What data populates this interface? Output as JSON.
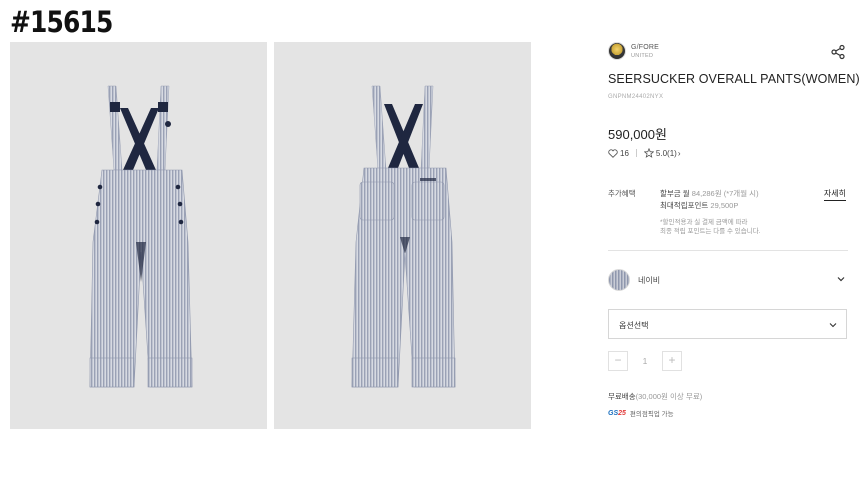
{
  "overlay_id": "#15615",
  "brand": {
    "name": "G/FORE",
    "sub": "UNITED"
  },
  "product": {
    "title": "SEERSUCKER OVERALL PANTS(WOMEN)",
    "code": "GNPNM24402NYX",
    "price": "590,000원"
  },
  "stats": {
    "likes": "16",
    "rating": "5.0(1)",
    "chevron": "›"
  },
  "benefits": {
    "label": "추가혜택",
    "installment_main": "할부금 월",
    "installment_muted": "84,286원 (*7개월 시)",
    "points_main": "최대적립포인트",
    "points_muted": "29,500P",
    "note_line1": "*할인적용과 실 결제 금액에 따라",
    "note_line2": "최종 적립 포인트는 다를 수 있습니다.",
    "detail_link": "자세히"
  },
  "color_option": {
    "name": "네이비",
    "swatch_color": "#8f97ad"
  },
  "option_select": {
    "label": "옵션선택"
  },
  "quantity": {
    "minus": "−",
    "value": "1",
    "plus": "+"
  },
  "shipping": {
    "main": "무료배송",
    "muted": "(30,000원 이상 무료)"
  },
  "pickup": {
    "logo_gs": "GS",
    "logo_25": "25",
    "text": "편의점픽업 가능"
  },
  "icons": {
    "share": "share-icon",
    "heart": "heart-icon",
    "star": "star-icon",
    "chevron_down": "chevron-down-icon"
  },
  "colors": {
    "photo_background": "#e4e4e4",
    "pants_stripe": "#b9bdc9",
    "strap_navy": "#1f2740"
  }
}
